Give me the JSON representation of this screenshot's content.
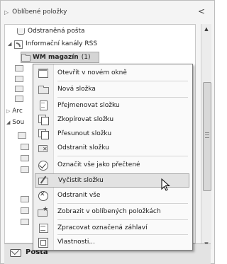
{
  "favorites": {
    "label": "Oblíbené položky",
    "collapse_glyph": "<"
  },
  "tree": {
    "deleted_label": "Odstraněná pošta",
    "rss_label": "Informační kanály RSS",
    "selected_label": "WM magazín",
    "selected_count": "(1)",
    "side_labels": [
      "Arc",
      "Sou"
    ]
  },
  "context_menu": {
    "items": [
      {
        "label": "Otevřít v novém okně",
        "icon": "new-window-icon"
      },
      {
        "label": "Nová složka",
        "icon": "new-folder-icon"
      },
      {
        "label": "Přejmenovat složku",
        "icon": "rename-icon"
      },
      {
        "label": "Zkopírovat složku",
        "icon": "copy-folder-icon"
      },
      {
        "label": "Přesunout složku",
        "icon": "move-folder-icon"
      },
      {
        "label": "Odstranit složku",
        "icon": "delete-folder-icon"
      },
      {
        "label": "Označit vše jako přečtené",
        "icon": "mark-read-icon"
      },
      {
        "label": "Vyčistit složku",
        "icon": "clean-up-icon"
      },
      {
        "label": "Odstranit vše",
        "icon": "delete-all-icon"
      },
      {
        "label": "Zobrazit v oblíbených položkách",
        "icon": "favorites-icon"
      },
      {
        "label": "Zpracovat označená záhlaví",
        "icon": "headers-icon"
      },
      {
        "label": "Vlastnosti...",
        "icon": "properties-icon"
      }
    ],
    "hovered_item": "Vyčistit složku"
  },
  "bottom": {
    "mail_label": "Pošta"
  }
}
